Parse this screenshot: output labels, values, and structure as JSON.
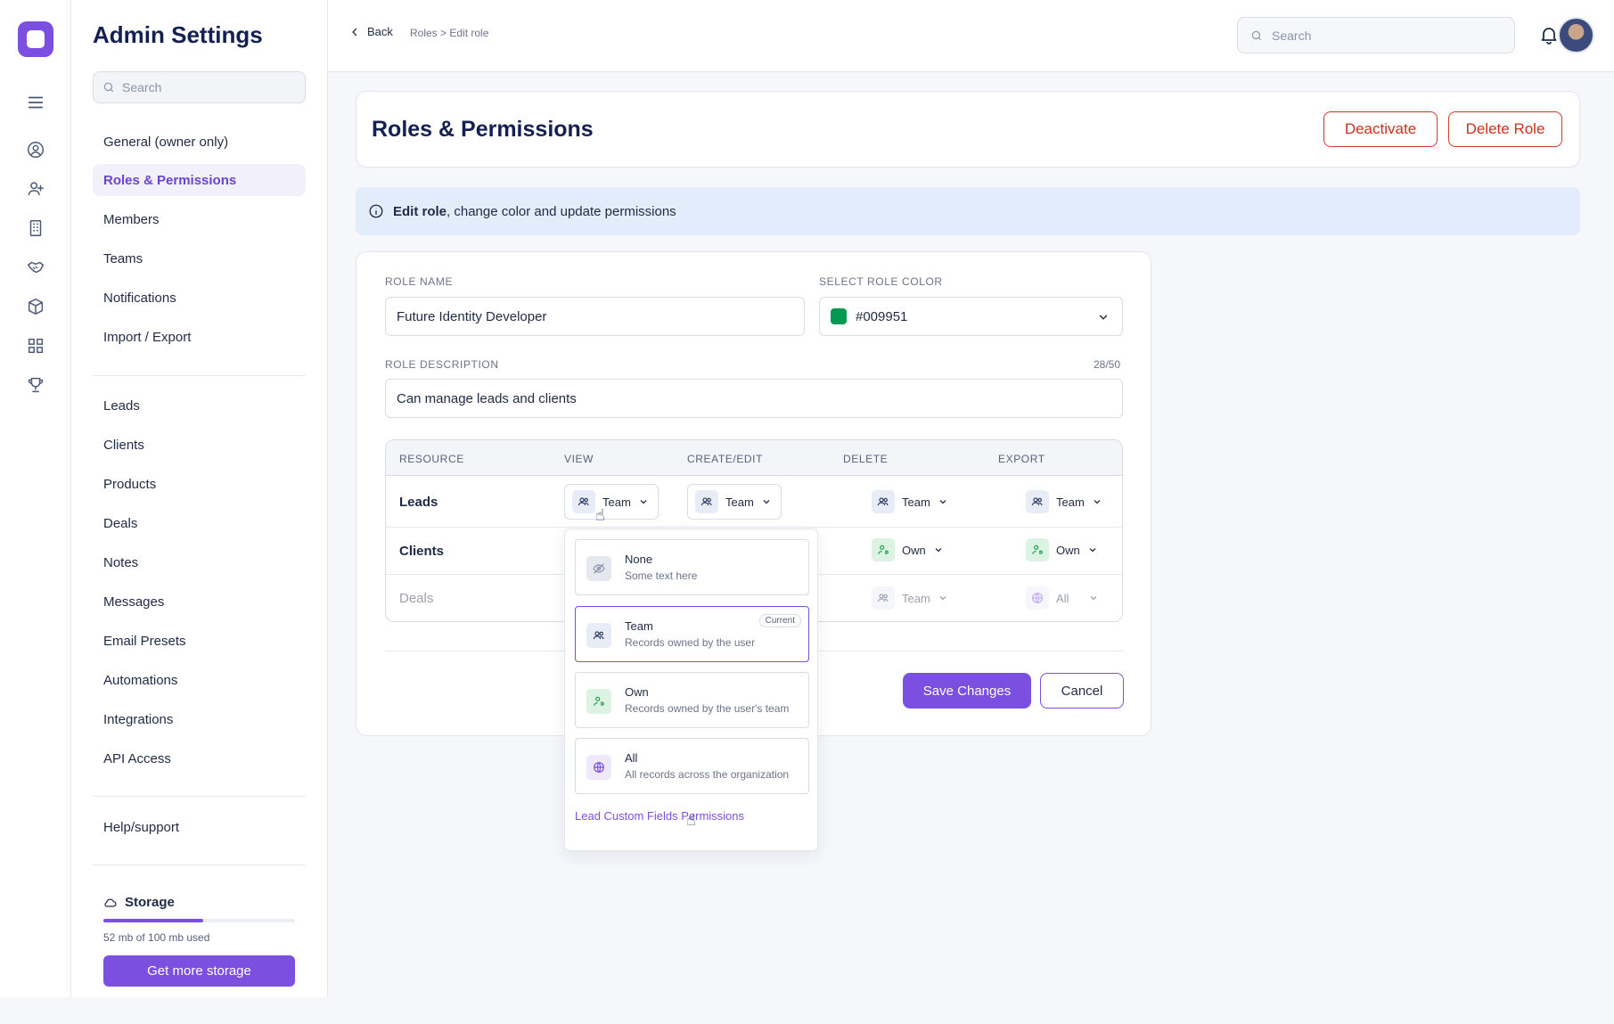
{
  "app": {
    "panel_title": "Admin Settings",
    "panel_search_placeholder": "Search"
  },
  "nav": {
    "group1": [
      "General (owner only)",
      "Roles & Permissions",
      "Members",
      "Teams",
      "Notifications",
      "Import / Export"
    ],
    "group2": [
      "Leads",
      "Clients",
      "Products",
      "Deals",
      "Notes",
      "Messages",
      "Email Presets",
      "Automations",
      "Integrations",
      "API Access"
    ],
    "group3": [
      "Help/support"
    ],
    "active": "Roles & Permissions"
  },
  "storage": {
    "title": "Storage",
    "used_text": "52 mb of 100 mb used",
    "used_fraction": 0.52,
    "button": "Get more storage"
  },
  "topbar": {
    "back": "Back",
    "breadcrumb": "Roles > Edit role",
    "search_placeholder": "Search"
  },
  "header": {
    "title": "Roles & Permissions",
    "deactivate": "Deactivate",
    "delete": "Delete Role"
  },
  "info": {
    "bold": "Edit role",
    "rest": ", change color and update permissions"
  },
  "form": {
    "role_name_label": "ROLE NAME",
    "role_name_value": "Future Identity Developer",
    "color_label": "SELECT ROLE COLOR",
    "color_value": "#009951",
    "color_hex": "#009951",
    "desc_label": "ROLE DESCRIPTION",
    "desc_counter": "28/50",
    "desc_value": "Can manage leads and clients"
  },
  "table": {
    "headers": [
      "RESOURCE",
      "VIEW",
      "CREATE/EDIT",
      "DELETE",
      "EXPORT"
    ],
    "rows": [
      {
        "name": "Leads",
        "view": "Team",
        "create": "Team",
        "delete": "Team",
        "export": "Team"
      },
      {
        "name": "Clients",
        "delete": "Own",
        "export": "Own"
      },
      {
        "name": "Deals",
        "delete": "Team",
        "export": "All"
      }
    ]
  },
  "actions": {
    "save": "Save Changes",
    "cancel": "Cancel"
  },
  "dropdown": {
    "options": [
      {
        "title": "None",
        "desc": "Some text here"
      },
      {
        "title": "Team",
        "desc": "Records owned by the user",
        "badge": "Current"
      },
      {
        "title": "Own",
        "desc": "Records owned by the user's team"
      },
      {
        "title": "All",
        "desc": "All records across the organization"
      }
    ],
    "link": "Lead Custom Fields Permissions"
  },
  "colors": {
    "accent": "#7b4fe0",
    "danger": "#d33a2c",
    "info_bg": "#e3ecfb"
  }
}
